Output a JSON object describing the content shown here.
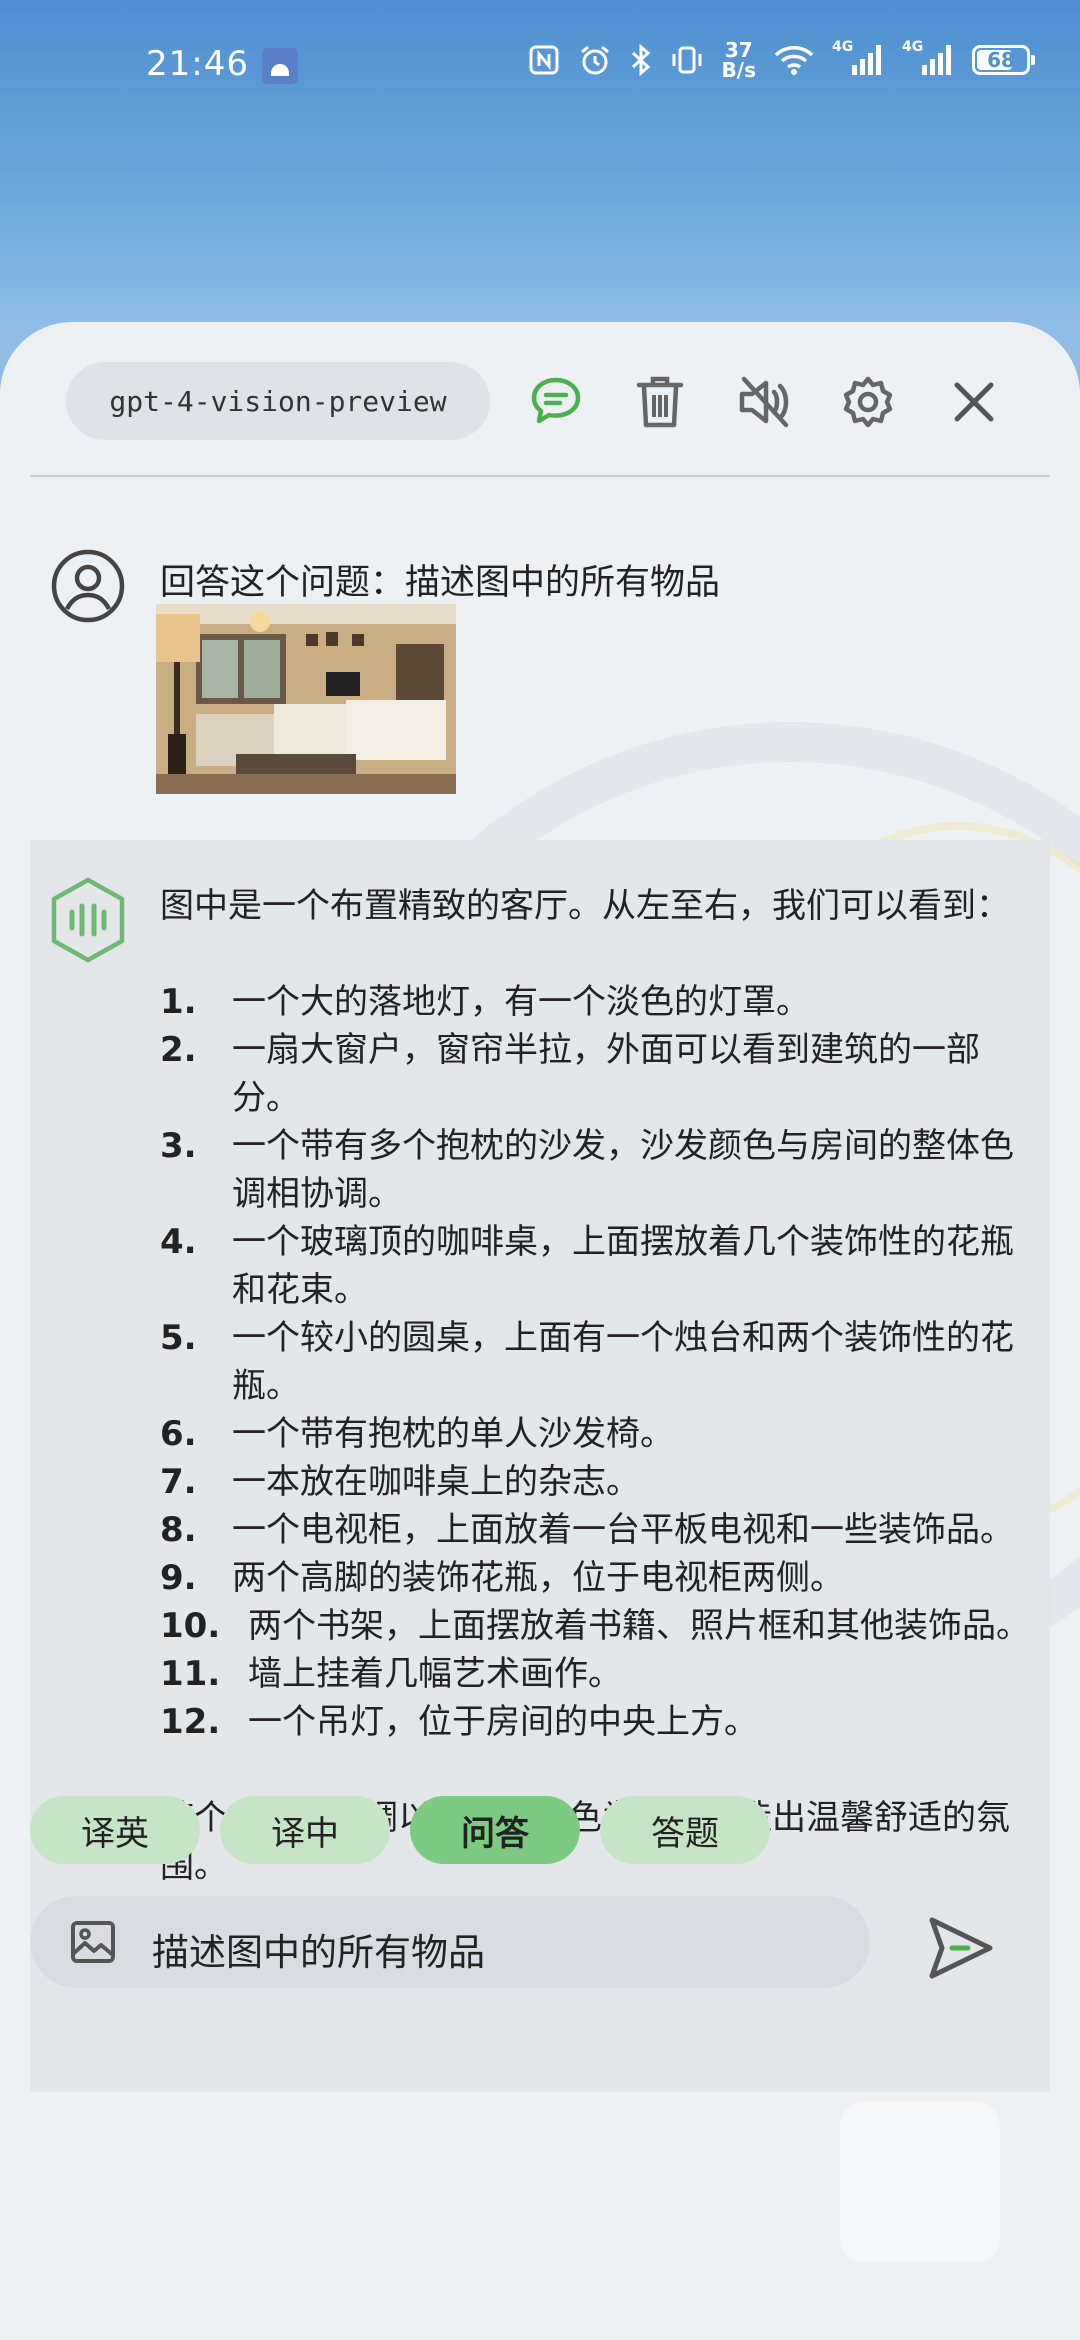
{
  "status_bar": {
    "time": "21:46",
    "net_speed_value": "37",
    "net_speed_unit": "B/s",
    "signal_1_label": "4G",
    "signal_2_label": "4G",
    "battery": "68"
  },
  "toolbar": {
    "model_name": "gpt-4-vision-preview"
  },
  "user_message": {
    "text": "回答这个问题：描述图中的所有物品"
  },
  "assistant_message": {
    "intro": "图中是一个布置精致的客厅。从左至右，我们可以看到：",
    "items": [
      {
        "num": "1.",
        "text": "一个大的落地灯，有一个淡色的灯罩。"
      },
      {
        "num": "2.",
        "text": "一扇大窗户，窗帘半拉，外面可以看到建筑的一部分。"
      },
      {
        "num": "3.",
        "text": "一个带有多个抱枕的沙发，沙发颜色与房间的整体色调相协调。"
      },
      {
        "num": "4.",
        "text": "一个玻璃顶的咖啡桌，上面摆放着几个装饰性的花瓶和花束。"
      },
      {
        "num": "5.",
        "text": "一个较小的圆桌，上面有一个烛台和两个装饰性的花瓶。"
      },
      {
        "num": "6.",
        "text": "一个带有抱枕的单人沙发椅。"
      },
      {
        "num": "7.",
        "text": "一本放在咖啡桌上的杂志。"
      },
      {
        "num": "8.",
        "text": "一个电视柜，上面放着一台平板电视和一些装饰品。"
      },
      {
        "num": "9.",
        "text": "两个高脚的装饰花瓶，位于电视柜两侧。"
      },
      {
        "num": "10.",
        "text": "两个书架，上面摆放着书籍、照片框和其他装饰品。"
      },
      {
        "num": "11.",
        "text": "墙上挂着几幅艺术画作。"
      },
      {
        "num": "12.",
        "text": "一个吊灯，位于房间的中央上方。"
      }
    ],
    "summary": "整个房间的色调以米色和白色为主，营造出温馨舒适的氛围。"
  },
  "quick_actions": [
    {
      "label": "译英"
    },
    {
      "label": "译中"
    },
    {
      "label": "问答"
    },
    {
      "label": "答题"
    }
  ],
  "input": {
    "value": "描述图中的所有物品"
  },
  "colors": {
    "accent_green": "#4caf50",
    "chip_green": "#c6e4c6",
    "chip_active": "#7dcb82"
  }
}
